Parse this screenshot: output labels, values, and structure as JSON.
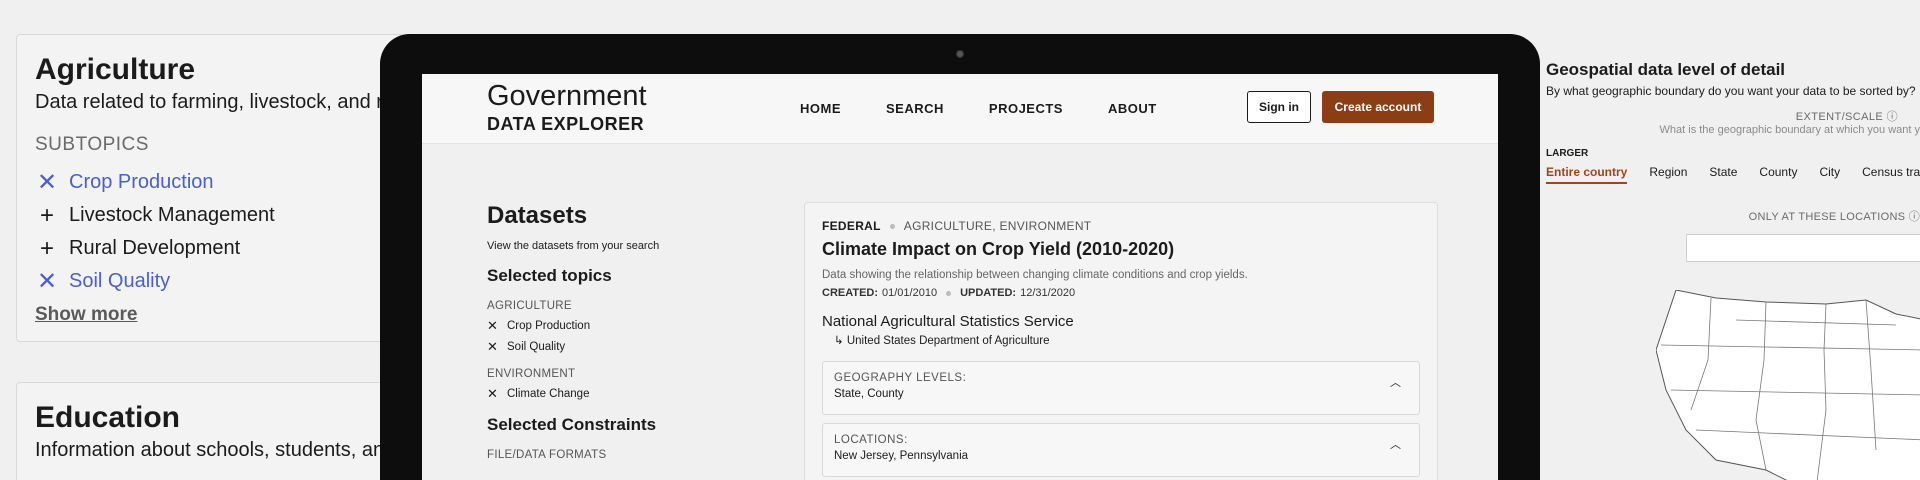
{
  "bg_left": {
    "agriculture": {
      "title": "Agriculture",
      "desc": "Data related to farming, livestock, and r",
      "subtopics_label": "SUBTOPICS",
      "topics": [
        {
          "label": "Crop Production",
          "selected": true
        },
        {
          "label": "Livestock Management",
          "selected": false
        },
        {
          "label": "Rural Development",
          "selected": false
        },
        {
          "label": "Soil Quality",
          "selected": true
        }
      ],
      "show_more": "Show more"
    },
    "education": {
      "title": "Education",
      "desc": "Information about schools, students, an"
    }
  },
  "bg_right": {
    "title": "Geospatial data level of detail",
    "question": "By what geographic boundary do you want your data to be sorted by?",
    "extent_label": "EXTENT/SCALE",
    "extent_desc": "What is the geographic boundary at which you want y",
    "larger_label": "LARGER",
    "scales": [
      "Entire country",
      "Region",
      "State",
      "County",
      "City",
      "Census tract"
    ],
    "active_scale": "Entire country",
    "only_label": "ONLY AT THESE LOCATIONS"
  },
  "header": {
    "logo_line1": "Government",
    "logo_line2": "DATA EXPLORER",
    "nav": [
      "HOME",
      "SEARCH",
      "PROJECTS",
      "ABOUT"
    ],
    "sign_in": "Sign in",
    "create_account": "Create account"
  },
  "filters": {
    "title": "Datasets",
    "subtitle": "View the datasets from your search",
    "selected_topics_title": "Selected topics",
    "groups": [
      {
        "name": "AGRICULTURE",
        "items": [
          "Crop Production",
          "Soil Quality"
        ]
      },
      {
        "name": "ENVIRONMENT",
        "items": [
          "Climate Change"
        ]
      }
    ],
    "constraints_title": "Selected Constraints",
    "constraints_first": "FILE/DATA FORMATS"
  },
  "result": {
    "level": "FEDERAL",
    "tags": "AGRICULTURE, ENVIRONMENT",
    "title": "Climate Impact on Crop Yield (2010-2020)",
    "description": "Data showing the relationship between changing climate conditions and crop yields.",
    "created_label": "CREATED:",
    "created": "01/01/2010",
    "updated_label": "UPDATED:",
    "updated": "12/31/2020",
    "source": "National Agricultural Statistics Service",
    "parent": "United States Department of Agriculture",
    "accordions": [
      {
        "label": "GEOGRAPHY LEVELS:",
        "value": "State, County"
      },
      {
        "label": "LOCATIONS:",
        "value": "New Jersey, Pennsylvania"
      }
    ]
  },
  "colors": {
    "accent": "#8b3d14",
    "link": "#4a5fc8",
    "frame": "#0d0d0d"
  }
}
